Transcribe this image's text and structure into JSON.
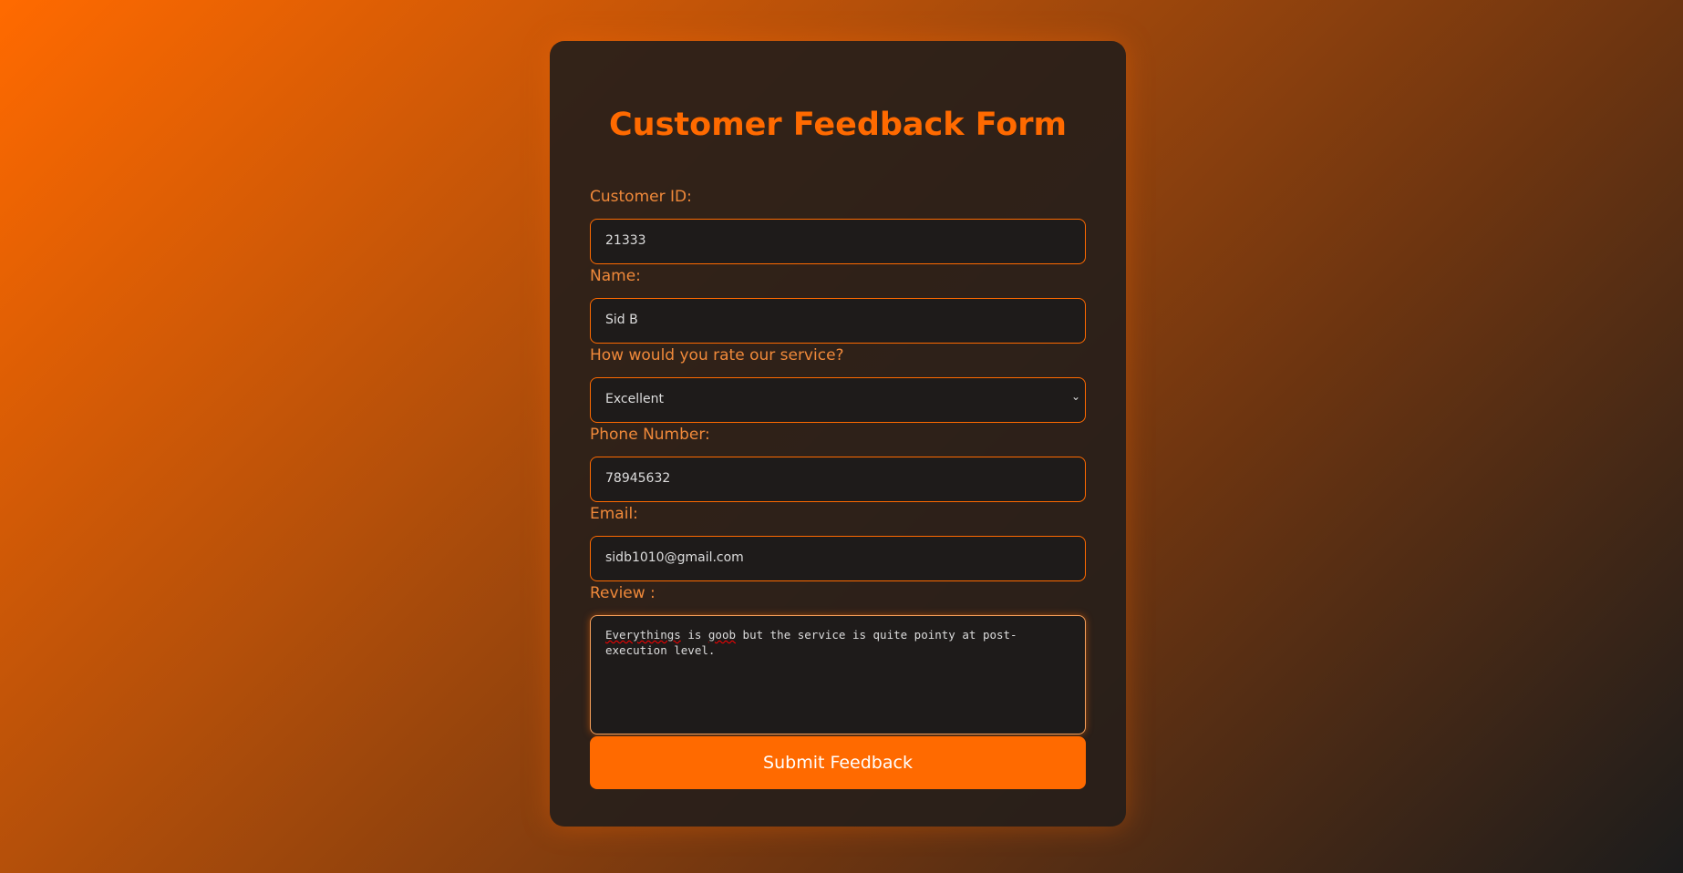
{
  "title": "Customer Feedback Form",
  "fields": {
    "customer_id": {
      "label": "Customer ID:",
      "value": "21333"
    },
    "name": {
      "label": "Name:",
      "value": "Sid B"
    },
    "rating": {
      "label": "How would you rate our service?",
      "value": "Excellent"
    },
    "phone": {
      "label": "Phone Number:",
      "value": "78945632"
    },
    "email": {
      "label": "Email:",
      "value": "sidb1010@gmail.com"
    },
    "review": {
      "label": "Review :",
      "value": "Everythings is goob but the service is quite pointy at post-execution level.",
      "parts": [
        "Everythings",
        " is ",
        "goob",
        " but the service is quite pointy at post-execution level."
      ]
    }
  },
  "submit_label": "Submit Feedback",
  "colors": {
    "accent": "#ff6a00",
    "card": "#261e1a",
    "input_bg": "#1e1b1a"
  },
  "icons": {
    "select": "chevron-down-icon"
  }
}
